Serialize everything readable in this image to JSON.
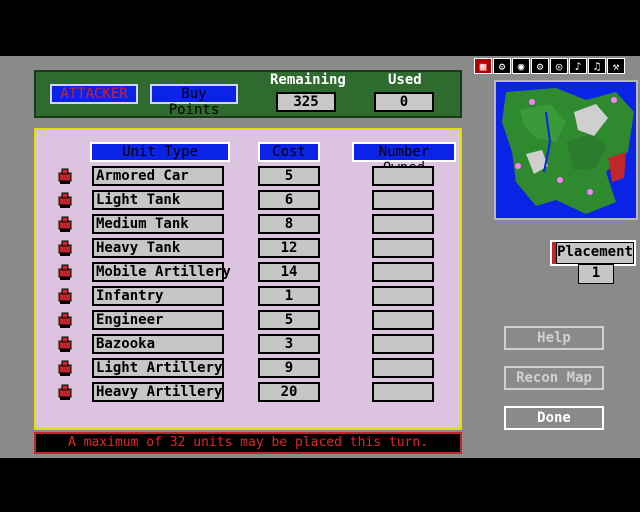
{
  "header": {
    "attacker_label": "ATTACKER",
    "buy_points_label": "Buy Points",
    "remaining_label": "Remaining",
    "remaining_value": "325",
    "used_label": "Used",
    "used_value": "0"
  },
  "table": {
    "columns": [
      "Unit Type",
      "Cost",
      "Number Owned"
    ],
    "rows": [
      {
        "name": "Armored Car",
        "cost": "5",
        "icon": "armored-car-icon"
      },
      {
        "name": "Light Tank",
        "cost": "6",
        "icon": "light-tank-icon"
      },
      {
        "name": "Medium Tank",
        "cost": "8",
        "icon": "medium-tank-icon"
      },
      {
        "name": "Heavy Tank",
        "cost": "12",
        "icon": "heavy-tank-icon"
      },
      {
        "name": "Mobile Artillery",
        "cost": "14",
        "icon": "mobile-artillery-icon"
      },
      {
        "name": "Infantry",
        "cost": "1",
        "icon": "infantry-icon"
      },
      {
        "name": "Engineer",
        "cost": "5",
        "icon": "engineer-icon"
      },
      {
        "name": "Bazooka",
        "cost": "3",
        "icon": "bazooka-icon"
      },
      {
        "name": "Light Artillery",
        "cost": "9",
        "icon": "light-artillery-icon"
      },
      {
        "name": "Heavy Artillery",
        "cost": "20",
        "icon": "heavy-artillery-icon"
      }
    ]
  },
  "status": "A maximum of 32 units may be placed this turn.",
  "toolbar": [
    "grid-icon",
    "gear-icon",
    "binoculars-icon",
    "settings-icon",
    "disk-icon",
    "music-icon",
    "sound-icon",
    "tools-icon"
  ],
  "placement": {
    "label": "Placement",
    "value": "1"
  },
  "buttons": {
    "help": "Help",
    "recon": "Recon Map",
    "done": "Done"
  },
  "colors": {
    "panel": "#dcc3e0",
    "header": "#2f6a2f",
    "accent_blue": "#0b23e6",
    "alert_red": "#c0272d"
  }
}
